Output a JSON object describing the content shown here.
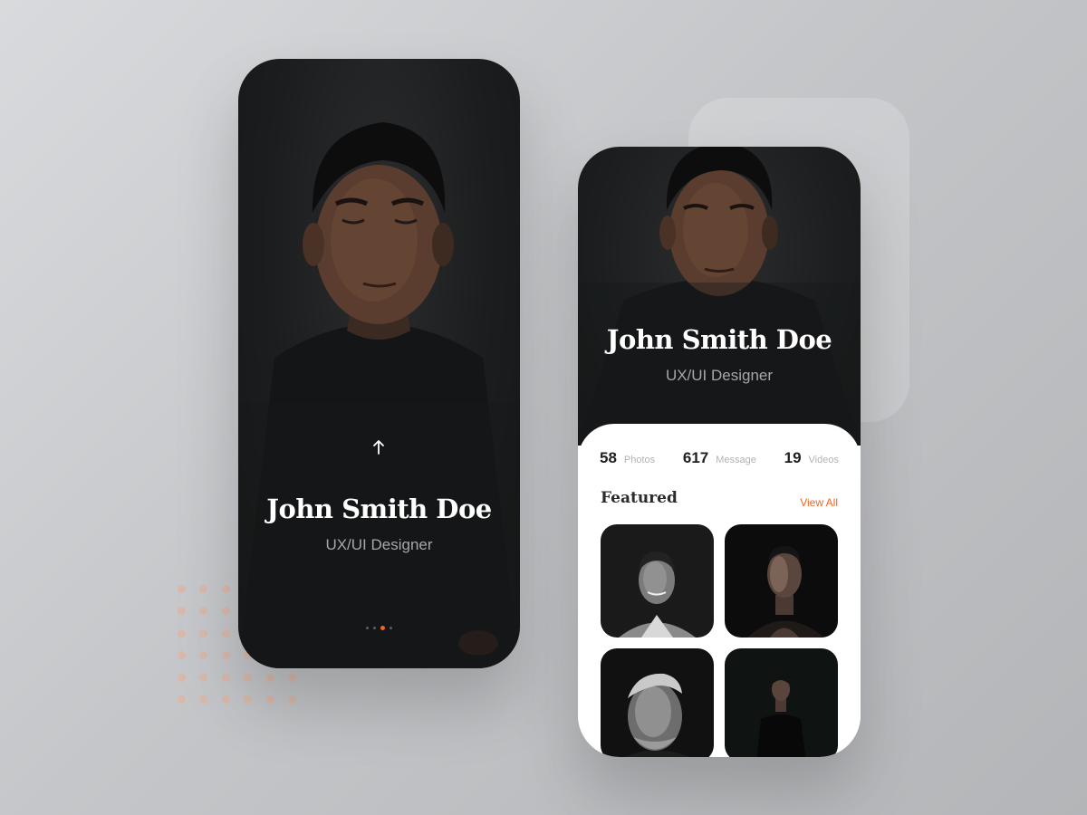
{
  "profile": {
    "name": "John Smith Doe",
    "role": "UX/UI Designer"
  },
  "onboarding": {
    "pager_count": 4,
    "pager_active": 2
  },
  "stats": [
    {
      "value": "58",
      "label": "Photos"
    },
    {
      "value": "617",
      "label": "Message"
    },
    {
      "value": "19",
      "label": "Videos"
    }
  ],
  "featured": {
    "title": "Featured",
    "view_all": "View All"
  },
  "colors": {
    "accent": "#f26522",
    "dark": "#1b1d1e"
  },
  "icons": {
    "scroll_up": "up-arrow-icon"
  }
}
